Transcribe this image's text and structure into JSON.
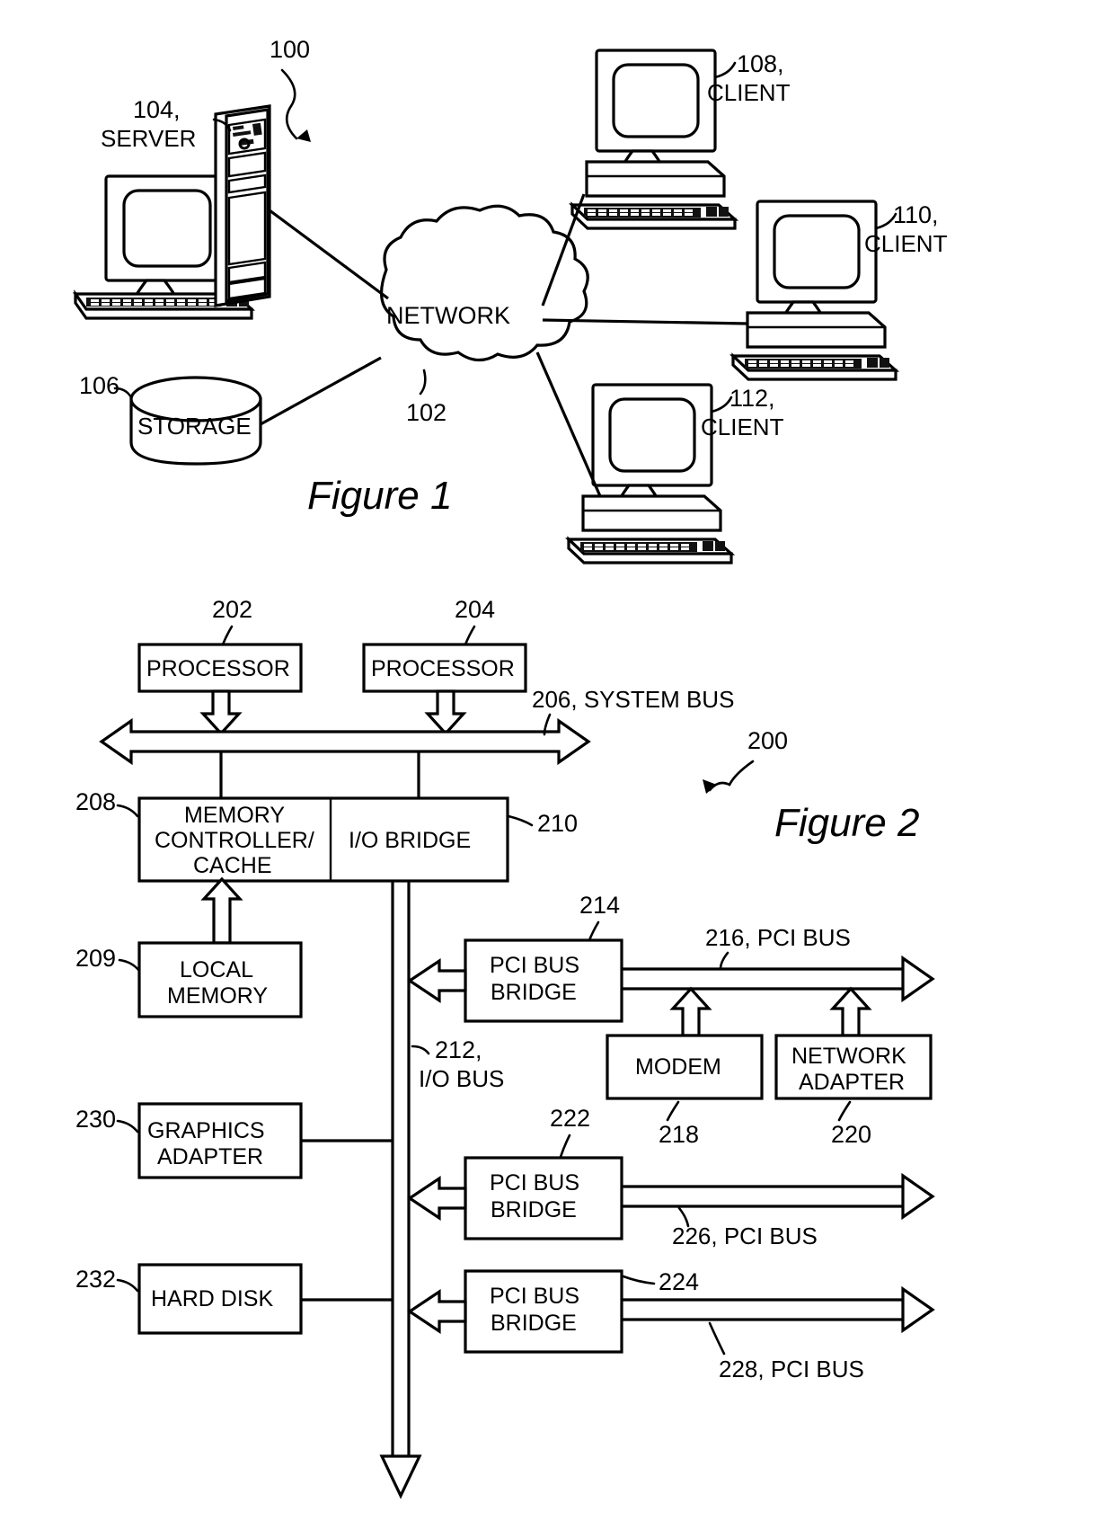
{
  "document": {
    "type": "patent-drawing-sheet",
    "figures": [
      {
        "caption": "Figure 1",
        "system_ref": "100",
        "nodes": [
          {
            "ref": "104,",
            "label": "SERVER",
            "kind": "server-computer"
          },
          {
            "ref": "106",
            "label": "STORAGE",
            "kind": "storage-cylinder"
          },
          {
            "ref": "102",
            "label": "NETWORK",
            "kind": "network-cloud"
          },
          {
            "ref": "108,",
            "label": "CLIENT",
            "kind": "client-computer"
          },
          {
            "ref": "110,",
            "label": "CLIENT",
            "kind": "client-computer"
          },
          {
            "ref": "112,",
            "label": "CLIENT",
            "kind": "client-computer"
          }
        ]
      },
      {
        "caption": "Figure 2",
        "system_ref": "200",
        "blocks": [
          {
            "ref": "202",
            "label": "PROCESSOR"
          },
          {
            "ref": "204",
            "label": "PROCESSOR"
          },
          {
            "ref": "208",
            "label": "MEMORY CONTROLLER/ CACHE",
            "lines": [
              "MEMORY",
              "CONTROLLER/",
              "CACHE"
            ]
          },
          {
            "ref": "210",
            "label": "I/O BRIDGE",
            "lines": [
              "I/O BRIDGE"
            ]
          },
          {
            "ref": "209",
            "label": "LOCAL MEMORY",
            "lines": [
              "LOCAL",
              "MEMORY"
            ]
          },
          {
            "ref": "214",
            "label": "PCI BUS BRIDGE",
            "lines": [
              "PCI BUS",
              "BRIDGE"
            ]
          },
          {
            "ref": "218",
            "label": "MODEM",
            "lines": [
              "MODEM"
            ]
          },
          {
            "ref": "220",
            "label": "NETWORK ADAPTER",
            "lines": [
              "NETWORK",
              "ADAPTER"
            ]
          },
          {
            "ref": "230",
            "label": "GRAPHICS ADAPTER",
            "lines": [
              "GRAPHICS",
              "ADAPTER"
            ]
          },
          {
            "ref": "222",
            "label": "PCI BUS BRIDGE",
            "lines": [
              "PCI BUS",
              "BRIDGE"
            ]
          },
          {
            "ref": "232",
            "label": "HARD DISK",
            "lines": [
              "HARD DISK"
            ]
          },
          {
            "ref": "224",
            "label": "PCI BUS BRIDGE",
            "lines": [
              "PCI BUS",
              "BRIDGE"
            ]
          }
        ],
        "buses": [
          {
            "ref": "206, SYSTEM BUS"
          },
          {
            "ref": "212,",
            "ref2": "I/O BUS"
          },
          {
            "ref": "216, PCI BUS"
          },
          {
            "ref": "226, PCI BUS"
          },
          {
            "ref": "228, PCI BUS"
          }
        ]
      }
    ]
  },
  "fig1": {
    "sys_ref": "100",
    "server_ref": "104,",
    "server_label": "SERVER",
    "storage_ref": "106",
    "storage_label": "STORAGE",
    "network_label": "NETWORK",
    "network_ref": "102",
    "client1_ref": "108,",
    "client1_label": "CLIENT",
    "client2_ref": "110,",
    "client2_label": "CLIENT",
    "client3_ref": "112,",
    "client3_label": "CLIENT",
    "caption": "Figure 1"
  },
  "fig2": {
    "caption": "Figure 2",
    "sys_ref": "200",
    "proc1_ref": "202",
    "proc1_label": "PROCESSOR",
    "proc2_ref": "204",
    "proc2_label": "PROCESSOR",
    "sysbus_label": "206, SYSTEM BUS",
    "memctl_ref": "208",
    "memctl_l1": "MEMORY",
    "memctl_l2": "CONTROLLER/",
    "memctl_l3": "CACHE",
    "iobridge_ref": "210",
    "iobridge_label": "I/O BRIDGE",
    "localmem_ref": "209",
    "localmem_l1": "LOCAL",
    "localmem_l2": "MEMORY",
    "iobus_ref": "212,",
    "iobus_label": "I/O BUS",
    "pcibridge1_ref": "214",
    "pcibridge1_l1": "PCI BUS",
    "pcibridge1_l2": "BRIDGE",
    "pcibus1_label": "216, PCI BUS",
    "modem_label": "MODEM",
    "modem_ref": "218",
    "netadapter_l1": "NETWORK",
    "netadapter_l2": "ADAPTER",
    "netadapter_ref": "220",
    "graphics_ref": "230",
    "graphics_l1": "GRAPHICS",
    "graphics_l2": "ADAPTER",
    "pcibridge2_ref": "222",
    "pcibridge2_l1": "PCI BUS",
    "pcibridge2_l2": "BRIDGE",
    "pcibus2_label": "226, PCI BUS",
    "harddisk_ref": "232",
    "harddisk_label": "HARD DISK",
    "pcibridge3_ref": "224",
    "pcibridge3_l1": "PCI BUS",
    "pcibridge3_l2": "BRIDGE",
    "pcibus3_label": "228, PCI BUS"
  }
}
